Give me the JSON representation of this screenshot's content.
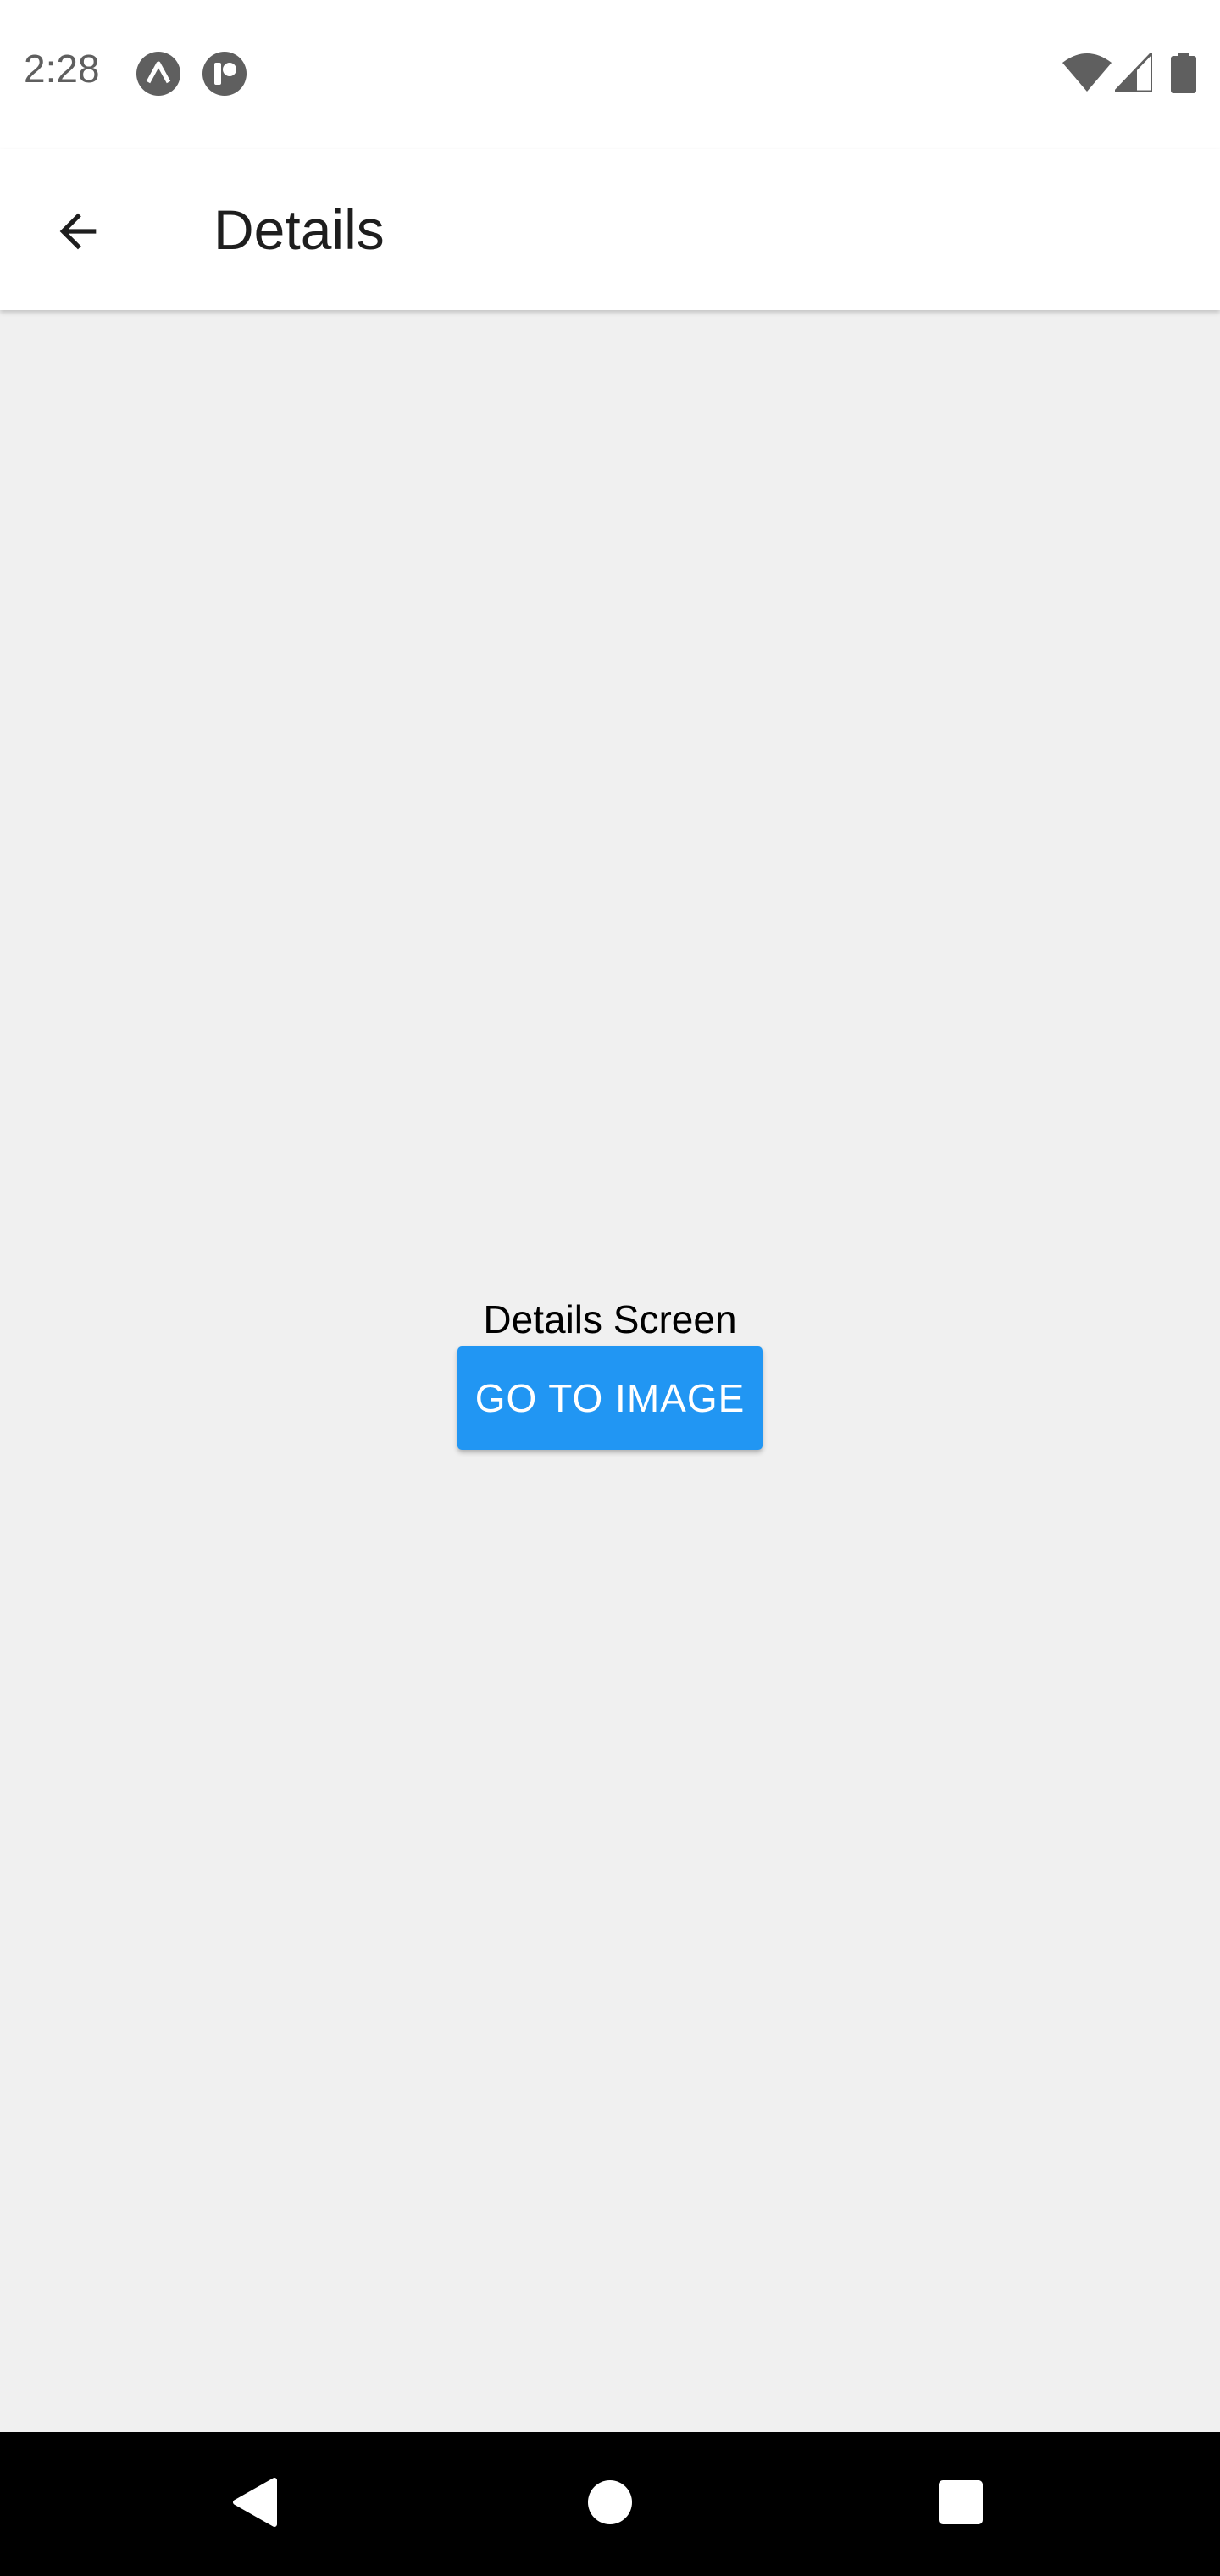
{
  "status_bar": {
    "time": "2:28",
    "notification_icons": [
      "expo-icon",
      "notification-app-icon"
    ],
    "system_icons": [
      "wifi-icon",
      "cellular-signal-icon",
      "battery-icon"
    ],
    "icon_color": "#5f5f5f"
  },
  "app_bar": {
    "title": "Details",
    "back_icon": "arrow-back-icon"
  },
  "main": {
    "label": "Details Screen",
    "button_label": "GO TO IMAGE",
    "button_color": "#2196f3",
    "background_color": "#f0f0f0"
  },
  "nav_bar": {
    "buttons": [
      "back-triangle-icon",
      "home-circle-icon",
      "recents-square-icon"
    ]
  }
}
